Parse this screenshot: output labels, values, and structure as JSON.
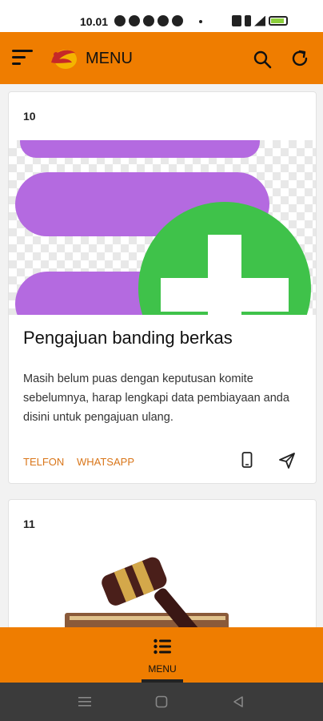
{
  "status_bar": {
    "time": "10.01",
    "battery_level": 0.9
  },
  "app_bar": {
    "title": "MENU",
    "accent_color": "#ef7d00",
    "icons": [
      "menu-icon",
      "logo-icon",
      "search-icon",
      "refresh-icon"
    ]
  },
  "cards": [
    {
      "number": "10",
      "title": "Pengajuan banding berkas",
      "description": "Masih belum puas dengan keputusan komite sebelumnya, harap lengkapi data pembiayaan anda disini untuk pengajuan ulang.",
      "action_1": "TELFON",
      "action_2": "WHATSAPP",
      "action_icons": [
        "phone-icon",
        "send-icon"
      ],
      "image_icon": "database-add-icon"
    },
    {
      "number": "11",
      "image_icon": "gavel-icon"
    }
  ],
  "bottom_nav": {
    "menu_label": "MENU"
  },
  "system_nav": {
    "icons": [
      "recent-apps-icon",
      "home-icon",
      "back-icon"
    ]
  }
}
